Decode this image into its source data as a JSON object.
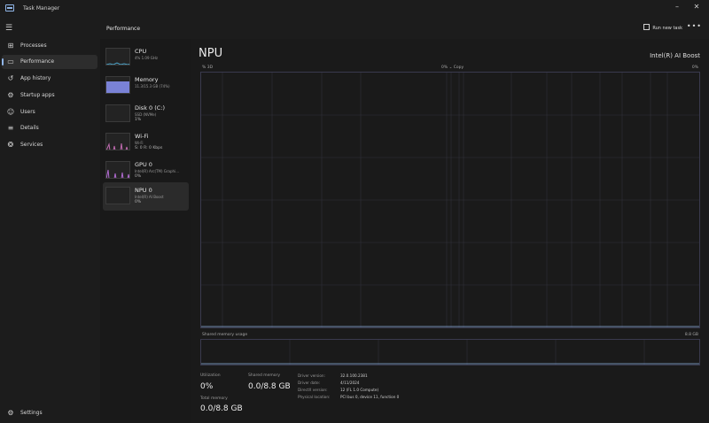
{
  "window": {
    "title": "Task Manager"
  },
  "sidebar": {
    "items": [
      {
        "label": "Processes",
        "icon": "processes-icon"
      },
      {
        "label": "Performance",
        "icon": "performance-icon"
      },
      {
        "label": "App history",
        "icon": "history-icon"
      },
      {
        "label": "Startup apps",
        "icon": "startup-icon"
      },
      {
        "label": "Users",
        "icon": "users-icon"
      },
      {
        "label": "Details",
        "icon": "details-icon"
      },
      {
        "label": "Services",
        "icon": "services-icon"
      }
    ],
    "settings_label": "Settings"
  },
  "header": {
    "title": "Performance",
    "run_task_label": "Run new task",
    "more_label": "•••"
  },
  "devices": [
    {
      "name": "CPU",
      "sub": "4% 1.09 GHz",
      "value": ""
    },
    {
      "name": "Memory",
      "sub": "11.3/15.3 GB (74%)",
      "value": ""
    },
    {
      "name": "Disk 0 (C:)",
      "sub": "SSD (NVMe)",
      "value": "1%"
    },
    {
      "name": "Wi-Fi",
      "sub": "Wi-Fi",
      "value": "S: 0 R: 0 Kbps"
    },
    {
      "name": "GPU 0",
      "sub": "Intel(R) Arc(TM) Graphi...",
      "value": "0%"
    },
    {
      "name": "NPU 0",
      "sub": "Intel(R) AI Boost",
      "value": "0%"
    }
  ],
  "main": {
    "title": "NPU",
    "model": "Intel(R) AI Boost",
    "graph_top_left": "% 3D",
    "graph_top_mid": "0% ⌄ Copy",
    "graph_top_right": "0%",
    "shared_label": "Shared memory usage",
    "shared_right": "8.8 GB",
    "utilization_label": "Utilization",
    "utilization_value": "0%",
    "shared_memory_label": "Shared memory",
    "shared_memory_value": "0.0/8.8 GB",
    "total_memory_label": "Total memory",
    "total_memory_value": "0.0/8.8 GB",
    "info": [
      {
        "k": "Driver version:",
        "v": "32.0.100.2381"
      },
      {
        "k": "Driver date:",
        "v": "4/11/2024"
      },
      {
        "k": "DirectX version:",
        "v": "12 (FL 1.0 Compute)"
      },
      {
        "k": "Physical location:",
        "v": "PCI bus 0, device 11, function 0"
      }
    ]
  },
  "colors": {
    "accent": "#8fb4e6",
    "graph_border": "#3a3a4e",
    "cpu_line": "#4aa3c8",
    "memory_fill": "#7a82d6",
    "wifi_line": "#c06ab0",
    "gpu_line": "#b06ad0"
  }
}
